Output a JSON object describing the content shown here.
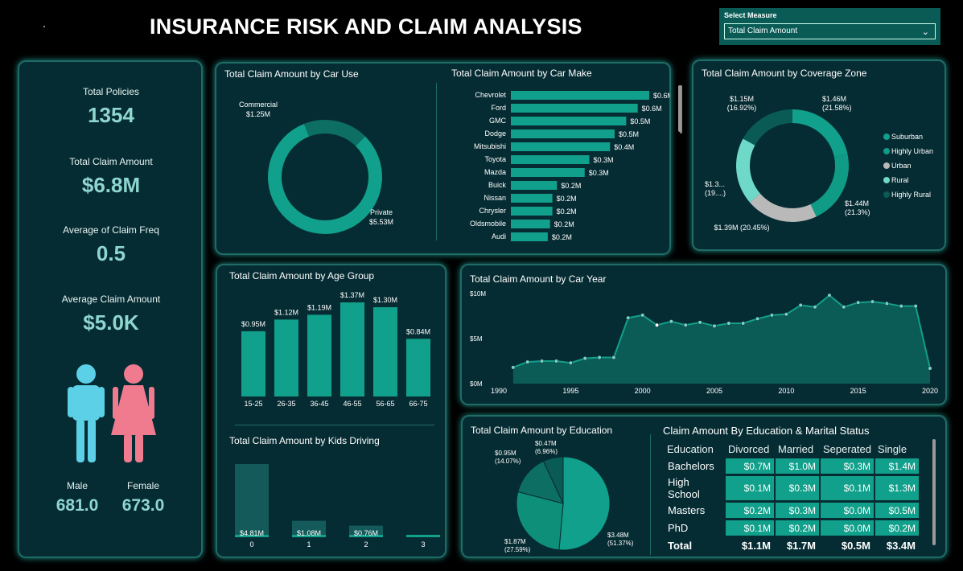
{
  "header": {
    "title": "INSURANCE RISK AND CLAIM ANALYSIS"
  },
  "select_measure": {
    "label": "Select Measure",
    "value": "Total Claim Amount"
  },
  "kpis": {
    "total_policies": {
      "label": "Total Policies",
      "value": "1354"
    },
    "total_claim": {
      "label": "Total Claim Amount",
      "value": "$6.8M"
    },
    "avg_claim_freq": {
      "label": "Average of Claim Freq",
      "value": "0.5"
    },
    "avg_claim_amount": {
      "label": "Average Claim Amount",
      "value": "$5.0K"
    },
    "male": {
      "label": "Male",
      "value": "681.0"
    },
    "female": {
      "label": "Female",
      "value": "673.0"
    }
  },
  "colors": {
    "accent": "#11a08b",
    "dark_teal": "#0a5b56",
    "panel_bg": "#062c33",
    "male": "#5bd0e6",
    "female": "#f07b8f"
  },
  "chart_data": [
    {
      "id": "car_use",
      "type": "pie",
      "title": "Total Claim Amount by Car Use",
      "categories": [
        "Commercial",
        "Private"
      ],
      "values": [
        1.25,
        5.53
      ],
      "labels": [
        "$1.25M",
        "$5.53M"
      ],
      "donut": true
    },
    {
      "id": "car_make",
      "type": "bar",
      "orientation": "horizontal",
      "title": "Total Claim Amount by Car Make",
      "categories": [
        "Chevrolet",
        "Ford",
        "GMC",
        "Dodge",
        "Mitsubishi",
        "Toyota",
        "Mazda",
        "Buick",
        "Nissan",
        "Chrysler",
        "Oldsmobile",
        "Audi"
      ],
      "values": [
        0.6,
        0.55,
        0.5,
        0.45,
        0.43,
        0.34,
        0.32,
        0.2,
        0.18,
        0.18,
        0.17,
        0.16
      ],
      "labels": [
        "$0.6M",
        "$0.6M",
        "$0.5M",
        "$0.5M",
        "$0.4M",
        "$0.3M",
        "$0.3M",
        "$0.2M",
        "$0.2M",
        "$0.2M",
        "$0.2M",
        "$0.2M"
      ]
    },
    {
      "id": "coverage_zone",
      "type": "pie",
      "donut": true,
      "title": "Total Claim Amount by Coverage Zone",
      "categories": [
        "Suburban",
        "Highly Urban",
        "Urban",
        "Rural",
        "Highly Rural"
      ],
      "values": [
        1.46,
        1.44,
        1.39,
        1.3,
        1.15
      ],
      "labels": [
        "$1.46M\n(21.58%)",
        "$1.44M\n(21.3%)",
        "$1.39M (20.45%)",
        "$1.3...\n(19....)",
        "$1.15M\n(16.92%)"
      ],
      "colors": [
        "#11a08b",
        "#0f9b86",
        "#b9b9b9",
        "#6fd9c8",
        "#0a5b56"
      ]
    },
    {
      "id": "age_group",
      "type": "bar",
      "title": "Total Claim Amount by Age Group",
      "categories": [
        "15-25",
        "26-35",
        "36-45",
        "46-55",
        "56-65",
        "66-75"
      ],
      "values": [
        0.95,
        1.12,
        1.19,
        1.37,
        1.3,
        0.84
      ],
      "labels": [
        "$0.95M",
        "$1.12M",
        "$1.19M",
        "$1.37M",
        "$1.30M",
        "$0.84M"
      ]
    },
    {
      "id": "kids_driving",
      "type": "bar",
      "title": "Total Claim Amount by Kids Driving",
      "categories": [
        "0",
        "1",
        "2",
        "3"
      ],
      "values": [
        4.81,
        1.08,
        0.76,
        0.15
      ],
      "labels": [
        "$4.81M",
        "$1.08M",
        "$0.76M",
        ""
      ]
    },
    {
      "id": "car_year",
      "type": "area",
      "title": "Total Claim Amount by Car Year",
      "x": [
        1991,
        1992,
        1993,
        1994,
        1995,
        1996,
        1997,
        1998,
        1999,
        2000,
        2001,
        2002,
        2003,
        2004,
        2005,
        2006,
        2007,
        2008,
        2009,
        2010,
        2011,
        2012,
        2013,
        2014,
        2015,
        2016,
        2017,
        2018,
        2019,
        2020
      ],
      "values": [
        1.8,
        2.4,
        2.5,
        2.5,
        2.3,
        2.8,
        2.9,
        2.9,
        7.3,
        7.6,
        6.5,
        6.9,
        6.5,
        6.8,
        6.4,
        6.7,
        6.7,
        7.2,
        7.6,
        7.7,
        8.7,
        8.5,
        9.8,
        8.5,
        9.0,
        9.1,
        8.9,
        8.6,
        8.6,
        1.7
      ],
      "xlabel": "",
      "ylabel": "",
      "yticks": [
        "$0M",
        "$5M",
        "$10M"
      ],
      "xticks": [
        "1990",
        "1995",
        "2000",
        "2005",
        "2010",
        "2015",
        "2020"
      ],
      "ylim": [
        0,
        10
      ]
    },
    {
      "id": "education",
      "type": "pie",
      "title": "Total Claim Amount by Education",
      "categories": [
        "Bachelors",
        "High School",
        "Masters",
        "PhD"
      ],
      "values": [
        3.48,
        1.87,
        0.95,
        0.47
      ],
      "labels": [
        "$3.48M\n(51.37%)",
        "$1.87M\n(27.59%)",
        "$0.95M\n(14.07%)",
        "$0.47M\n(6.96%)"
      ],
      "colors": [
        "#11a08b",
        "#0e8f79",
        "#0d6f63",
        "#0a5b56"
      ]
    },
    {
      "id": "edu_marital",
      "type": "table",
      "title": "Claim Amount By Education & Marital Status",
      "columns": [
        "Education",
        "Divorced",
        "Married",
        "Seperated",
        "Single"
      ],
      "rows": [
        [
          "Bachelors",
          "$0.7M",
          "$1.0M",
          "$0.3M",
          "$1.4M"
        ],
        [
          "High School",
          "$0.1M",
          "$0.3M",
          "$0.1M",
          "$1.3M"
        ],
        [
          "Masters",
          "$0.2M",
          "$0.3M",
          "$0.0M",
          "$0.5M"
        ],
        [
          "PhD",
          "$0.1M",
          "$0.2M",
          "$0.0M",
          "$0.2M"
        ]
      ],
      "total": [
        "Total",
        "$1.1M",
        "$1.7M",
        "$0.5M",
        "$3.4M"
      ]
    }
  ]
}
